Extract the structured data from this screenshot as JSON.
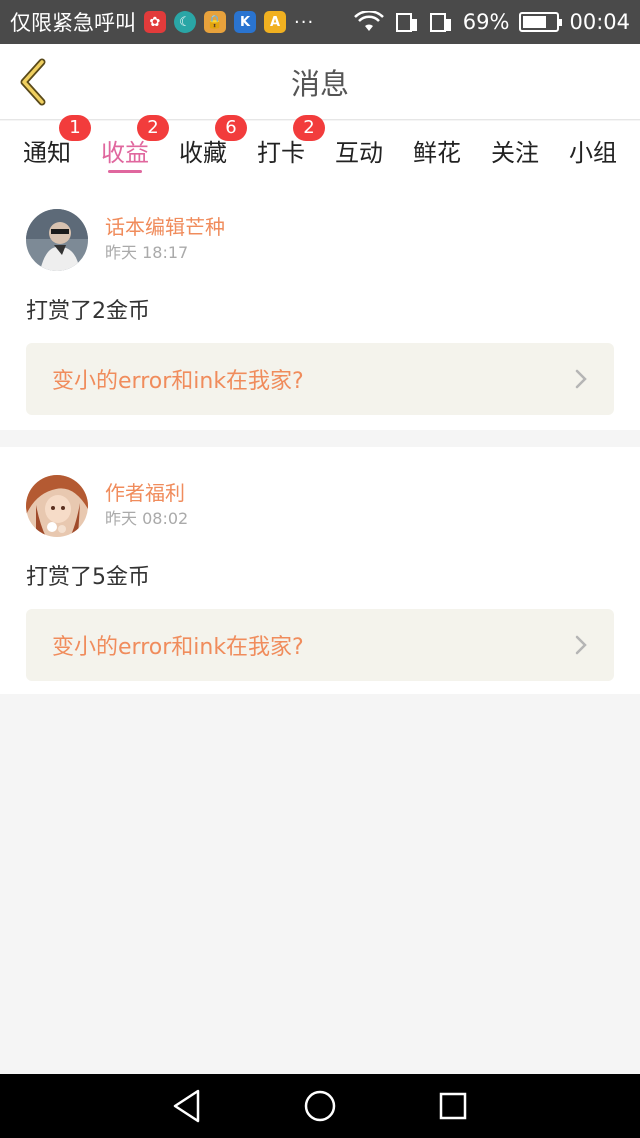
{
  "status_bar": {
    "carrier_text": "仅限紧急呼叫",
    "app_icons": [
      {
        "name": "photo-app-icon",
        "color": "#e23b3b"
      },
      {
        "name": "moon-app-icon",
        "color": "#2aa6a6"
      },
      {
        "name": "lock-app-icon",
        "color": "#e8a23c"
      },
      {
        "name": "k-app-icon",
        "color": "#2a74d0"
      },
      {
        "name": "a-app-icon",
        "color": "#f0b020"
      }
    ],
    "more": "···",
    "battery_percent": "69%",
    "battery_level": 0.69,
    "time": "00:04"
  },
  "header": {
    "title": "消息"
  },
  "tabs": [
    {
      "label": "通知",
      "badge": "1",
      "active": false
    },
    {
      "label": "收益",
      "badge": "2",
      "active": true
    },
    {
      "label": "收藏",
      "badge": "6",
      "active": false
    },
    {
      "label": "打卡",
      "badge": "2",
      "active": false
    },
    {
      "label": "互动",
      "badge": null,
      "active": false
    },
    {
      "label": "鲜花",
      "badge": null,
      "active": false
    },
    {
      "label": "关注",
      "badge": null,
      "active": false
    },
    {
      "label": "小组",
      "badge": null,
      "active": false
    }
  ],
  "cards": [
    {
      "user": "话本编辑芒种",
      "time": "昨天 18:17",
      "text": "打赏了2金币",
      "link": "变小的error和ink在我家?"
    },
    {
      "user": "作者福利",
      "time": "昨天 08:02",
      "text": "打赏了5金币",
      "link": "变小的error和ink在我家?"
    }
  ],
  "colors": {
    "accent": "#e0679e",
    "orange": "#f08c5c",
    "badge": "#f23c3c"
  }
}
